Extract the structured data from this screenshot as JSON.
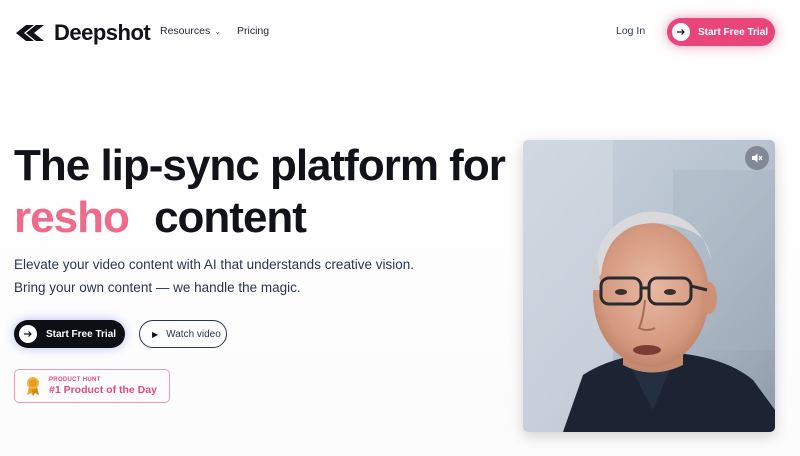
{
  "brand": {
    "name": "Deepshot"
  },
  "nav": {
    "resources_label": "Resources",
    "pricing_label": "Pricing",
    "login_label": "Log In",
    "cta_label": "Start Free Trial"
  },
  "hero": {
    "headline_line1": "The lip-sync platform for",
    "headline_typed": "resho",
    "headline_line2_rest": "content",
    "subtitle_line1": "Elevate your video content with AI that understands creative vision.",
    "subtitle_line2": "Bring your own content — we handle the magic.",
    "primary_cta": "Start Free Trial",
    "secondary_cta": "Watch video"
  },
  "badge": {
    "small_text": "PRODUCT HUNT",
    "big_text": "#1 Product of the Day"
  },
  "colors": {
    "accent_pink": "#e8467b",
    "typed_pink": "#ef6b8a",
    "dark": "#0d0f14"
  },
  "icons": {
    "mute": "speaker-muted-icon",
    "arrow": "arrow-right-icon",
    "play": "play-icon",
    "medal": "medal-icon"
  }
}
